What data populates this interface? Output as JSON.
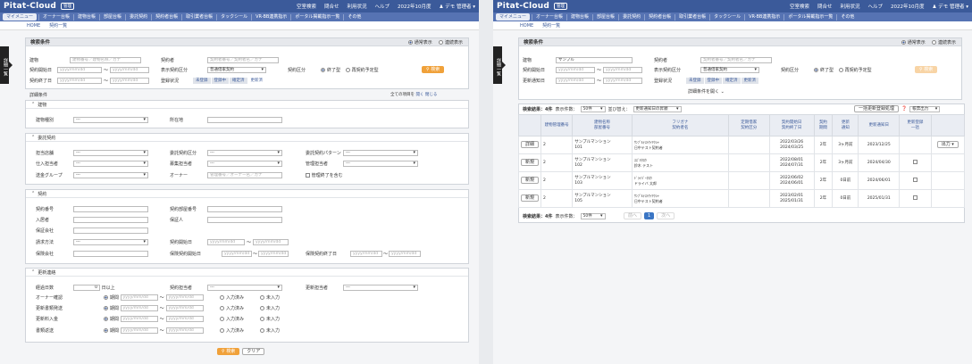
{
  "header": {
    "logo": "Pitat-Cloud",
    "tag": "管理",
    "links": [
      "空室検索",
      "問合せ",
      "利用状況",
      "ヘルプ",
      "2022年10月度",
      "デモ 管理者 ▾"
    ]
  },
  "nav": {
    "my": "マイメニュー",
    "items": [
      "オーナー台帳",
      "建物台帳",
      "部屋台帳",
      "委託契約",
      "契約者台帳",
      "取引業者台帳",
      "タックシール",
      "VR-BB連携指示",
      "ポータル掲載指示一覧",
      "その他"
    ]
  },
  "crumbs": [
    "HOME",
    "契約一覧"
  ],
  "sidetab": "詳細一覧",
  "search": {
    "title": "検索条件",
    "mode_normal": "通常表示",
    "mode_detail": "連続表示",
    "building_label": "建物",
    "building_ph": "建物番号／建物名称／カナ",
    "contractor_label": "契約者",
    "contractor_ph": "契約者番号／契約者名／カナ",
    "building_value": "サンプル",
    "start_label": "契約開始日",
    "end_label": "契約終了日",
    "renew_label": "更新通知日",
    "date_ph": "yyyy/mm/dd",
    "type_label": "表示契約区分",
    "type_value": "普通借家契約",
    "kind_label": "契約区分",
    "kind_a": "終了型",
    "kind_b": "再契約予定型",
    "search_btn": "検索",
    "status_label": "登録状況",
    "status_tags": [
      "未登録",
      "登録中",
      "確定済",
      "更新済"
    ],
    "detail_toggle": "詳細条件を開く"
  },
  "detail": {
    "title": "詳細条件",
    "all_label": "全ての項目を",
    "open": "開く",
    "close": "閉じる",
    "sections": [
      {
        "name": "建物",
        "rows": [
          [
            "建物種別",
            "所在地"
          ]
        ]
      },
      {
        "name": "委託契約",
        "rows": [
          [
            "担当店舗",
            "委託契約区分",
            "委託契約パターン"
          ],
          [
            "仕入担当者",
            "募集担当者",
            "管理担当者"
          ],
          [
            "送金グループ",
            "オーナー",
            ""
          ]
        ]
      },
      {
        "name": "契約",
        "rows": [
          [
            "契約番号",
            "契約部屋番号"
          ],
          [
            "入居者",
            "保証人"
          ],
          [
            "保証会社",
            ""
          ],
          [
            "請求方法",
            "契約開始日"
          ],
          [
            "保険会社",
            "保険契約開始日",
            "保険契約終了日"
          ]
        ]
      },
      {
        "name": "更新連絡",
        "rows": [
          [
            "経過日数",
            "契約担当者",
            "更新担当者"
          ],
          [
            "オーナー確認"
          ],
          [
            "更新書類発送"
          ],
          [
            "更新料入金"
          ],
          [
            "書類返送"
          ]
        ]
      }
    ],
    "opt_placeholder": "---",
    "days_value": "0",
    "days_suffix": "日以上",
    "input_a": "入力済み",
    "input_b": "未入力",
    "period": "期間",
    "include_end": "管理終了を含む",
    "owner_ph": "管理番号／オーナー名／カナ",
    "clear": "クリア"
  },
  "results": {
    "count_label": "検索結果：4件",
    "per_page_label": "表示件数：",
    "per_page": "50件",
    "sort_label": "並び替え：",
    "sort": "更新通知日の昇順",
    "bulk": "一括更新登録処理",
    "export": "帳票出力",
    "headers": [
      "",
      "建物管理番号",
      "建物名称\n部屋番号",
      "フリガナ\n契約者名",
      "定期借家\n契約区分",
      "契約開始日\n契約終了日",
      "契約\n期間",
      "更新\n通知",
      "更新通知日",
      "更新登録\n一括"
    ],
    "rows": [
      {
        "btn": "詳細",
        "no": "2",
        "bld": "サンプルマンション\n101",
        "kana": "ｻﾝﾌﾟﾙﾃｽﾄｹｲﾔｸｼｬ\n日中テスト契約者",
        "dates": "2022/03/26\n2024/03/25",
        "term": "2年",
        "notice": "3ヶ月前",
        "nday": "2023/12/25",
        "extra": "出力 ▾"
      },
      {
        "btn": "新規",
        "no": "2",
        "bld": "サンプルマンション\n102",
        "kana": "ｽｽﾞｷﾀﾛｳ\n鈴木 テスト",
        "dates": "2022/08/01\n2024/07/31",
        "term": "2年",
        "notice": "3ヶ月前",
        "nday": "2024/04/30",
        "extra": ""
      },
      {
        "btn": "新規",
        "no": "2",
        "bld": "サンプルマンション\n103",
        "kana": "ﾄﾞﾗｲﾊﾞｰﾀﾛｳ\nドライバ 太郎",
        "dates": "2022/06/02\n2024/06/01",
        "term": "2年",
        "notice": "0日前",
        "nday": "2024/06/01",
        "extra": ""
      },
      {
        "btn": "新規",
        "no": "2",
        "bld": "サンプルマンション\n105",
        "kana": "ｻﾝﾌﾟﾙﾃｽﾄｹｲﾔｸｼｬ\n日中テスト契約者",
        "dates": "2023/02/01\n2025/01/31",
        "term": "2年",
        "notice": "0日前",
        "nday": "2025/01/31",
        "extra": ""
      }
    ],
    "pager": {
      "prev": "前へ",
      "page": "1",
      "next": "次へ"
    }
  }
}
